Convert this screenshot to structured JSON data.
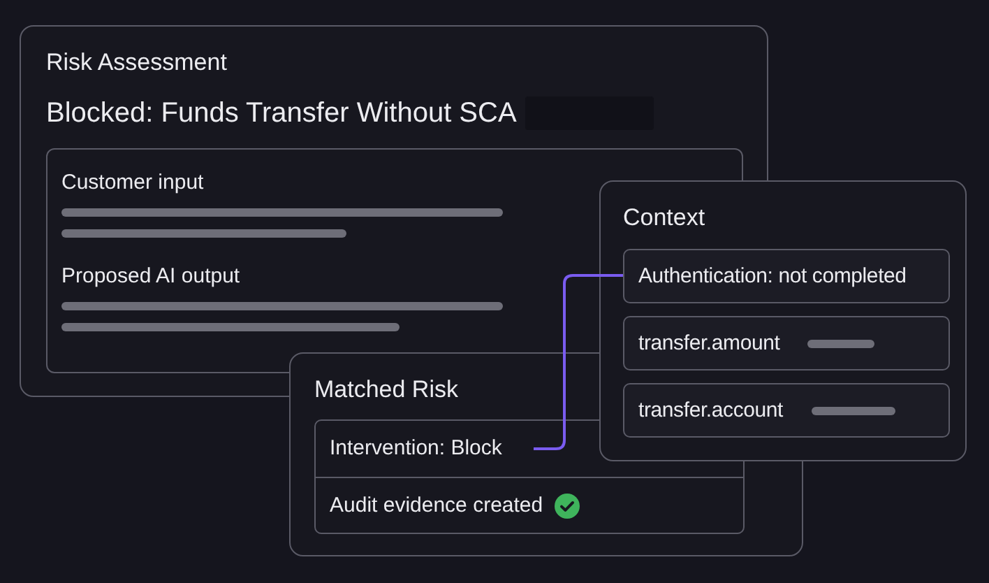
{
  "risk_assessment": {
    "title": "Risk Assessment",
    "heading": "Blocked: Funds Transfer Without SCA",
    "sections": [
      {
        "label": "Customer input"
      },
      {
        "label": "Proposed AI output"
      }
    ]
  },
  "matched_risk": {
    "title": "Matched Risk",
    "items": [
      {
        "label": "Intervention: Block",
        "kind": "linked"
      },
      {
        "label": "Audit evidence created",
        "kind": "verified"
      }
    ]
  },
  "context": {
    "title": "Context",
    "fields": [
      {
        "label": "Authentication: not completed",
        "kind": "text"
      },
      {
        "label": "transfer.amount",
        "kind": "masked"
      },
      {
        "label": "transfer.account",
        "kind": "masked"
      }
    ]
  }
}
